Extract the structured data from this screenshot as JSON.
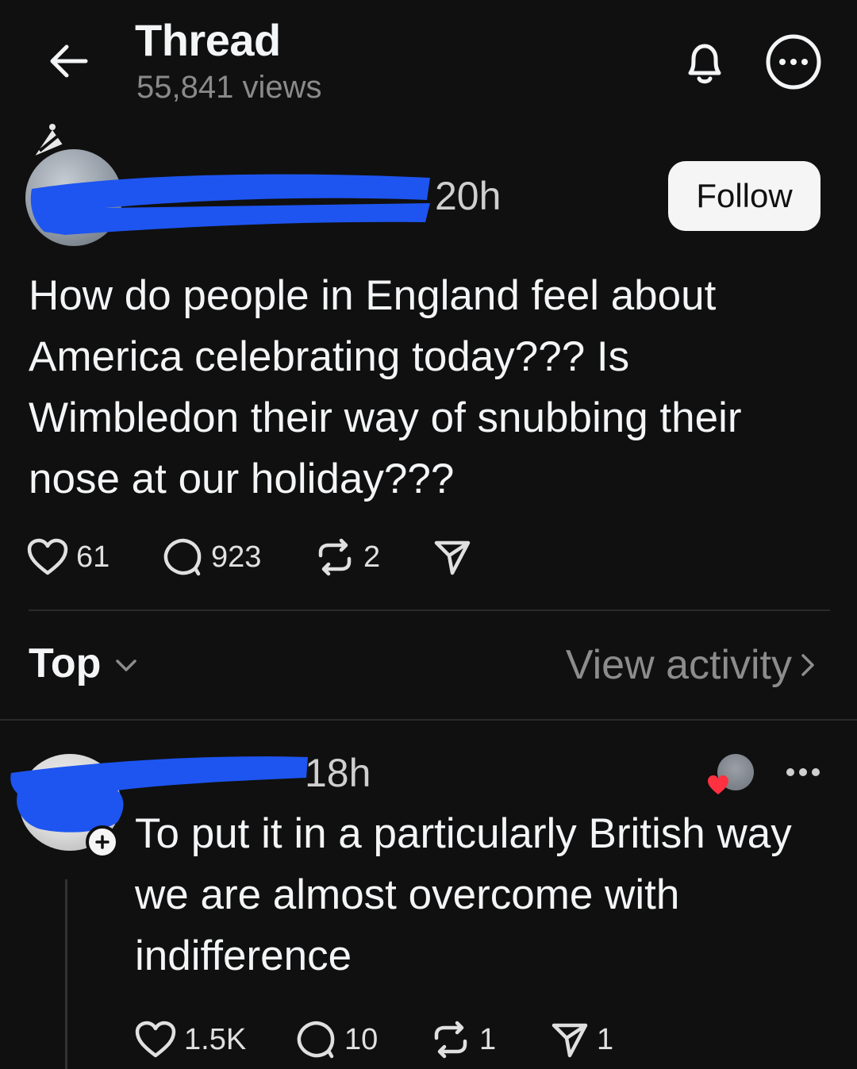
{
  "header": {
    "title": "Thread",
    "views": "55,841 views"
  },
  "post": {
    "time": "20h",
    "follow_label": "Follow",
    "text": "How do people in England feel about America celebrating today??? Is Wimbledon their way of snubbing their nose at our holiday???",
    "likes": "61",
    "comments": "923",
    "reposts": "2"
  },
  "sort": {
    "label": "Top",
    "view_activity": "View activity"
  },
  "reply": {
    "time": "18h",
    "text": "To put it in a particularly British way we are almost overcome with indifference",
    "likes": "1.5K",
    "comments": "10",
    "reposts": "1",
    "shares": "1"
  },
  "colors": {
    "background": "#101010",
    "redaction": "#1e55f0",
    "heart": "#ff3040"
  },
  "icons": [
    "back-arrow-icon",
    "bell-icon",
    "more-icon",
    "heart-icon",
    "comment-icon",
    "repost-icon",
    "share-icon",
    "chevron-down-icon",
    "chevron-right-icon",
    "plus-icon"
  ]
}
